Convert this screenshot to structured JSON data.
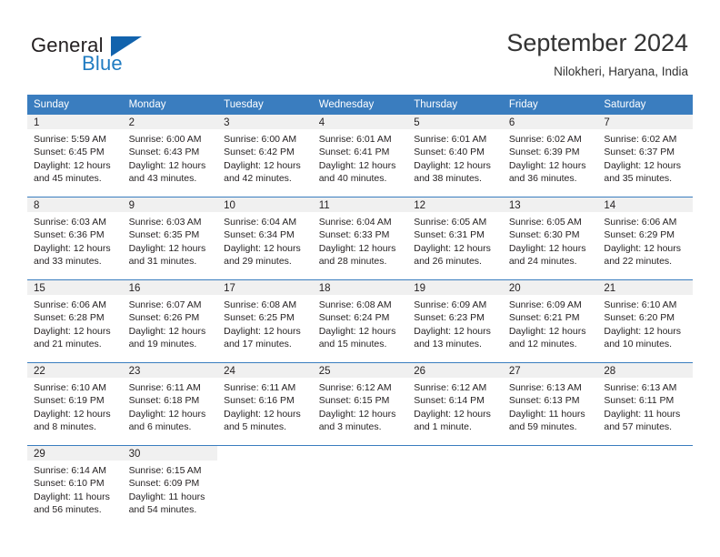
{
  "brand": {
    "name_part1": "General",
    "name_part2": "Blue",
    "logo_icon": "triangle-flag-icon",
    "accent_color": "#1263ad"
  },
  "header": {
    "month_title": "September 2024",
    "location": "Nilokheri, Haryana, India"
  },
  "calendar": {
    "header_color": "#3a7dbf",
    "daynum_strip_color": "#f0f0f0",
    "weekday_headers": [
      "Sunday",
      "Monday",
      "Tuesday",
      "Wednesday",
      "Thursday",
      "Friday",
      "Saturday"
    ],
    "weeks": [
      [
        {
          "day": "1",
          "sunrise": "Sunrise: 5:59 AM",
          "sunset": "Sunset: 6:45 PM",
          "daylight1": "Daylight: 12 hours",
          "daylight2": "and 45 minutes."
        },
        {
          "day": "2",
          "sunrise": "Sunrise: 6:00 AM",
          "sunset": "Sunset: 6:43 PM",
          "daylight1": "Daylight: 12 hours",
          "daylight2": "and 43 minutes."
        },
        {
          "day": "3",
          "sunrise": "Sunrise: 6:00 AM",
          "sunset": "Sunset: 6:42 PM",
          "daylight1": "Daylight: 12 hours",
          "daylight2": "and 42 minutes."
        },
        {
          "day": "4",
          "sunrise": "Sunrise: 6:01 AM",
          "sunset": "Sunset: 6:41 PM",
          "daylight1": "Daylight: 12 hours",
          "daylight2": "and 40 minutes."
        },
        {
          "day": "5",
          "sunrise": "Sunrise: 6:01 AM",
          "sunset": "Sunset: 6:40 PM",
          "daylight1": "Daylight: 12 hours",
          "daylight2": "and 38 minutes."
        },
        {
          "day": "6",
          "sunrise": "Sunrise: 6:02 AM",
          "sunset": "Sunset: 6:39 PM",
          "daylight1": "Daylight: 12 hours",
          "daylight2": "and 36 minutes."
        },
        {
          "day": "7",
          "sunrise": "Sunrise: 6:02 AM",
          "sunset": "Sunset: 6:37 PM",
          "daylight1": "Daylight: 12 hours",
          "daylight2": "and 35 minutes."
        }
      ],
      [
        {
          "day": "8",
          "sunrise": "Sunrise: 6:03 AM",
          "sunset": "Sunset: 6:36 PM",
          "daylight1": "Daylight: 12 hours",
          "daylight2": "and 33 minutes."
        },
        {
          "day": "9",
          "sunrise": "Sunrise: 6:03 AM",
          "sunset": "Sunset: 6:35 PM",
          "daylight1": "Daylight: 12 hours",
          "daylight2": "and 31 minutes."
        },
        {
          "day": "10",
          "sunrise": "Sunrise: 6:04 AM",
          "sunset": "Sunset: 6:34 PM",
          "daylight1": "Daylight: 12 hours",
          "daylight2": "and 29 minutes."
        },
        {
          "day": "11",
          "sunrise": "Sunrise: 6:04 AM",
          "sunset": "Sunset: 6:33 PM",
          "daylight1": "Daylight: 12 hours",
          "daylight2": "and 28 minutes."
        },
        {
          "day": "12",
          "sunrise": "Sunrise: 6:05 AM",
          "sunset": "Sunset: 6:31 PM",
          "daylight1": "Daylight: 12 hours",
          "daylight2": "and 26 minutes."
        },
        {
          "day": "13",
          "sunrise": "Sunrise: 6:05 AM",
          "sunset": "Sunset: 6:30 PM",
          "daylight1": "Daylight: 12 hours",
          "daylight2": "and 24 minutes."
        },
        {
          "day": "14",
          "sunrise": "Sunrise: 6:06 AM",
          "sunset": "Sunset: 6:29 PM",
          "daylight1": "Daylight: 12 hours",
          "daylight2": "and 22 minutes."
        }
      ],
      [
        {
          "day": "15",
          "sunrise": "Sunrise: 6:06 AM",
          "sunset": "Sunset: 6:28 PM",
          "daylight1": "Daylight: 12 hours",
          "daylight2": "and 21 minutes."
        },
        {
          "day": "16",
          "sunrise": "Sunrise: 6:07 AM",
          "sunset": "Sunset: 6:26 PM",
          "daylight1": "Daylight: 12 hours",
          "daylight2": "and 19 minutes."
        },
        {
          "day": "17",
          "sunrise": "Sunrise: 6:08 AM",
          "sunset": "Sunset: 6:25 PM",
          "daylight1": "Daylight: 12 hours",
          "daylight2": "and 17 minutes."
        },
        {
          "day": "18",
          "sunrise": "Sunrise: 6:08 AM",
          "sunset": "Sunset: 6:24 PM",
          "daylight1": "Daylight: 12 hours",
          "daylight2": "and 15 minutes."
        },
        {
          "day": "19",
          "sunrise": "Sunrise: 6:09 AM",
          "sunset": "Sunset: 6:23 PM",
          "daylight1": "Daylight: 12 hours",
          "daylight2": "and 13 minutes."
        },
        {
          "day": "20",
          "sunrise": "Sunrise: 6:09 AM",
          "sunset": "Sunset: 6:21 PM",
          "daylight1": "Daylight: 12 hours",
          "daylight2": "and 12 minutes."
        },
        {
          "day": "21",
          "sunrise": "Sunrise: 6:10 AM",
          "sunset": "Sunset: 6:20 PM",
          "daylight1": "Daylight: 12 hours",
          "daylight2": "and 10 minutes."
        }
      ],
      [
        {
          "day": "22",
          "sunrise": "Sunrise: 6:10 AM",
          "sunset": "Sunset: 6:19 PM",
          "daylight1": "Daylight: 12 hours",
          "daylight2": "and 8 minutes."
        },
        {
          "day": "23",
          "sunrise": "Sunrise: 6:11 AM",
          "sunset": "Sunset: 6:18 PM",
          "daylight1": "Daylight: 12 hours",
          "daylight2": "and 6 minutes."
        },
        {
          "day": "24",
          "sunrise": "Sunrise: 6:11 AM",
          "sunset": "Sunset: 6:16 PM",
          "daylight1": "Daylight: 12 hours",
          "daylight2": "and 5 minutes."
        },
        {
          "day": "25",
          "sunrise": "Sunrise: 6:12 AM",
          "sunset": "Sunset: 6:15 PM",
          "daylight1": "Daylight: 12 hours",
          "daylight2": "and 3 minutes."
        },
        {
          "day": "26",
          "sunrise": "Sunrise: 6:12 AM",
          "sunset": "Sunset: 6:14 PM",
          "daylight1": "Daylight: 12 hours",
          "daylight2": "and 1 minute."
        },
        {
          "day": "27",
          "sunrise": "Sunrise: 6:13 AM",
          "sunset": "Sunset: 6:13 PM",
          "daylight1": "Daylight: 11 hours",
          "daylight2": "and 59 minutes."
        },
        {
          "day": "28",
          "sunrise": "Sunrise: 6:13 AM",
          "sunset": "Sunset: 6:11 PM",
          "daylight1": "Daylight: 11 hours",
          "daylight2": "and 57 minutes."
        }
      ],
      [
        {
          "day": "29",
          "sunrise": "Sunrise: 6:14 AM",
          "sunset": "Sunset: 6:10 PM",
          "daylight1": "Daylight: 11 hours",
          "daylight2": "and 56 minutes."
        },
        {
          "day": "30",
          "sunrise": "Sunrise: 6:15 AM",
          "sunset": "Sunset: 6:09 PM",
          "daylight1": "Daylight: 11 hours",
          "daylight2": "and 54 minutes."
        },
        {
          "day": "",
          "sunrise": "",
          "sunset": "",
          "daylight1": "",
          "daylight2": ""
        },
        {
          "day": "",
          "sunrise": "",
          "sunset": "",
          "daylight1": "",
          "daylight2": ""
        },
        {
          "day": "",
          "sunrise": "",
          "sunset": "",
          "daylight1": "",
          "daylight2": ""
        },
        {
          "day": "",
          "sunrise": "",
          "sunset": "",
          "daylight1": "",
          "daylight2": ""
        },
        {
          "day": "",
          "sunrise": "",
          "sunset": "",
          "daylight1": "",
          "daylight2": ""
        }
      ]
    ]
  }
}
